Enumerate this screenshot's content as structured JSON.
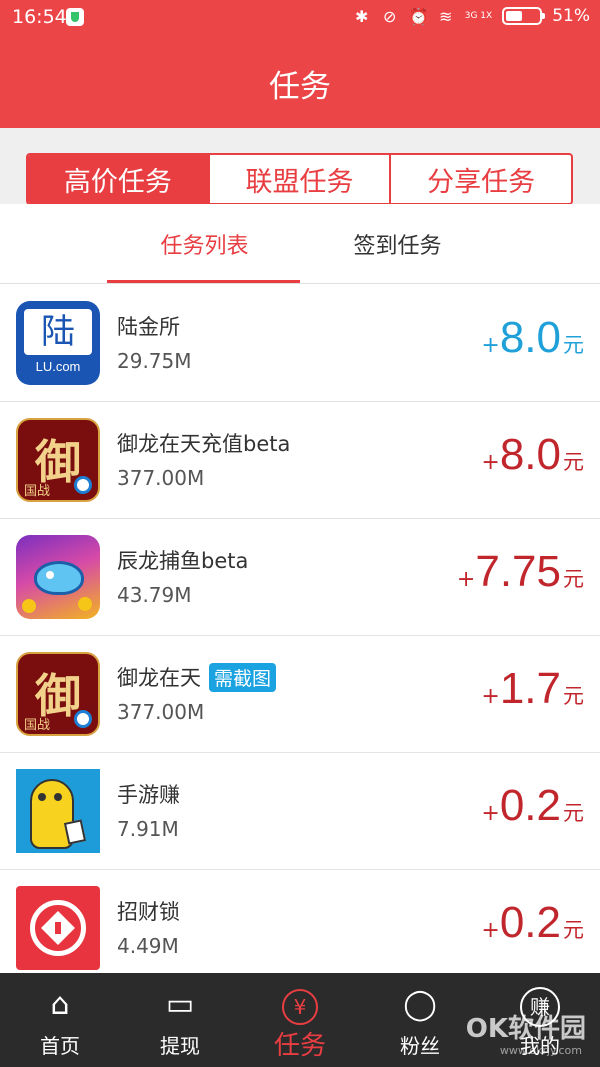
{
  "status_bar": {
    "time": "16:54",
    "network": "3G 1X",
    "battery": "51%",
    "battery_level": 0.51
  },
  "header": {
    "title": "任务"
  },
  "segments": [
    {
      "label": "高价任务",
      "active": true
    },
    {
      "label": "联盟任务",
      "active": false
    },
    {
      "label": "分享任务",
      "active": false
    }
  ],
  "tabs": [
    {
      "label": "任务列表",
      "active": true
    },
    {
      "label": "签到任务",
      "active": false
    }
  ],
  "tasks": [
    {
      "name": "陆金所",
      "size": "29.75M",
      "plus": "+",
      "reward": "8.0",
      "unit": "元",
      "color": "#1fa0d8",
      "tag": "",
      "icon": "lufax-app-icon"
    },
    {
      "name": "御龙在天充值beta",
      "size": "377.00M",
      "plus": "+",
      "reward": "8.0",
      "unit": "元",
      "color": "#c0262c",
      "tag": "",
      "icon": "yulong-app-icon"
    },
    {
      "name": "辰龙捕鱼beta",
      "size": "43.79M",
      "plus": "+",
      "reward": "7.75",
      "unit": "元",
      "color": "#c0262c",
      "tag": "",
      "icon": "fishing-app-icon"
    },
    {
      "name": "御龙在天",
      "size": "377.00M",
      "plus": "+",
      "reward": "1.7",
      "unit": "元",
      "color": "#c0262c",
      "tag": "需截图",
      "icon": "yulong-app-icon"
    },
    {
      "name": "手游赚",
      "size": "7.91M",
      "plus": "+",
      "reward": "0.2",
      "unit": "元",
      "color": "#c0262c",
      "tag": "",
      "icon": "shouyouzhuan-app-icon"
    },
    {
      "name": "招财锁",
      "size": "4.49M",
      "plus": "+",
      "reward": "0.2",
      "unit": "元",
      "color": "#c0262c",
      "tag": "",
      "icon": "zhaocaisuo-app-icon"
    }
  ],
  "icon_text": {
    "lufax_char": "陆",
    "lufax_domain": "LU.com",
    "yulong_char": "御",
    "yulong_sub": "国战"
  },
  "tabbar": [
    {
      "label": "首页",
      "icon": "home-icon",
      "glyph": "⌂",
      "active": false
    },
    {
      "label": "提现",
      "icon": "wallet-icon",
      "glyph": "▭",
      "active": false
    },
    {
      "label": "任务",
      "icon": "yen-coin-icon",
      "glyph": "¥",
      "active": true
    },
    {
      "label": "粉丝",
      "icon": "user-icon",
      "glyph": "◯",
      "active": false
    },
    {
      "label": "我的",
      "icon": "earn-icon",
      "glyph": "赚",
      "active": false
    }
  ],
  "watermark": {
    "text": "OK软件园",
    "url": "www.okrjy.com"
  }
}
